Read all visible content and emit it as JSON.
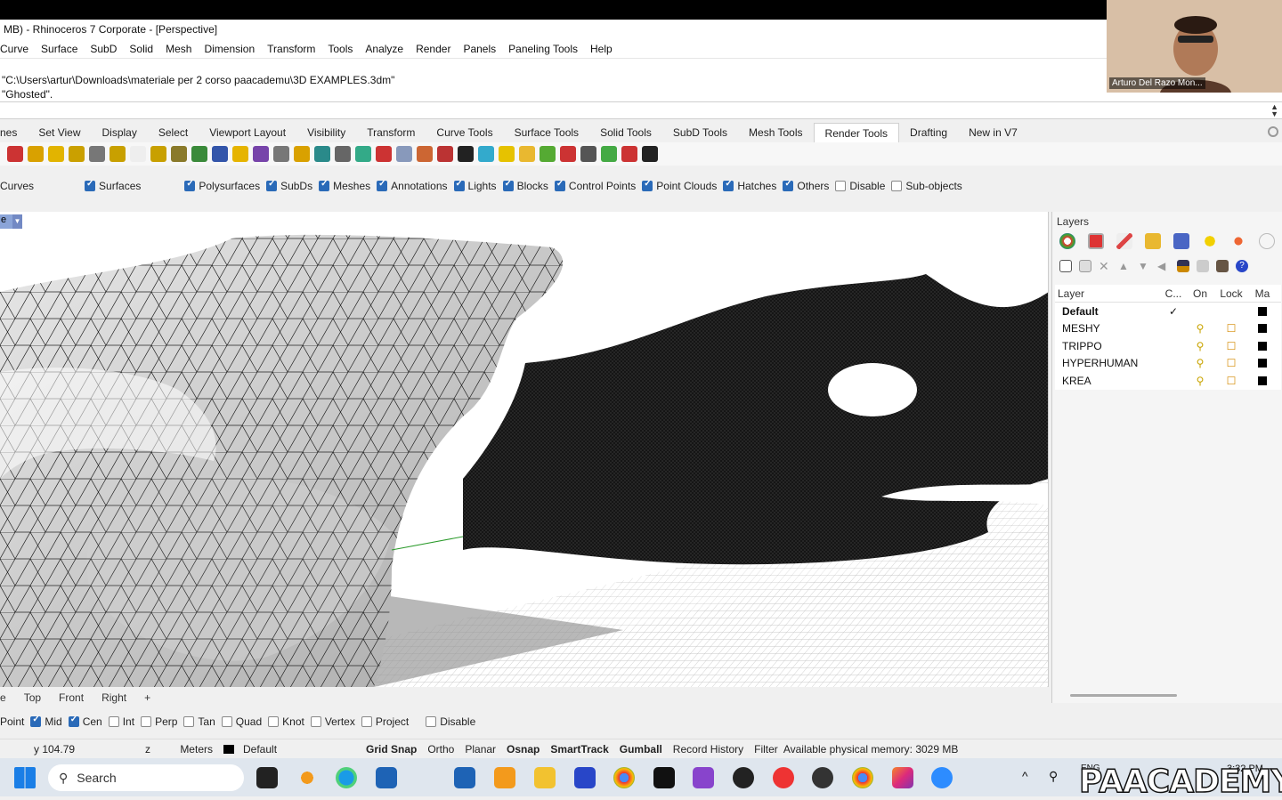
{
  "window": {
    "title": "MB) - Rhinoceros 7 Corporate - [Perspective]"
  },
  "menu": [
    "Curve",
    "Surface",
    "SubD",
    "Solid",
    "Mesh",
    "Dimension",
    "Transform",
    "Tools",
    "Analyze",
    "Render",
    "Panels",
    "Paneling Tools",
    "Help"
  ],
  "command_history": [
    "\"C:\\Users\\artur\\Downloads\\materiale per 2 corso paacademu\\3D EXAMPLES.3dm\"",
    "\"Ghosted\"."
  ],
  "tabs": [
    "nes",
    "Set View",
    "Display",
    "Select",
    "Viewport Layout",
    "Visibility",
    "Transform",
    "Curve Tools",
    "Surface Tools",
    "Solid Tools",
    "SubD Tools",
    "Mesh Tools",
    "Render Tools",
    "Drafting",
    "New in V7"
  ],
  "active_tab": "Render Tools",
  "filters": [
    {
      "label": "Curves",
      "checked": true
    },
    {
      "label": "Surfaces",
      "checked": true
    },
    {
      "label": "Polysurfaces",
      "checked": true
    },
    {
      "label": "SubDs",
      "checked": true
    },
    {
      "label": "Meshes",
      "checked": true
    },
    {
      "label": "Annotations",
      "checked": true
    },
    {
      "label": "Lights",
      "checked": true
    },
    {
      "label": "Blocks",
      "checked": true
    },
    {
      "label": "Control Points",
      "checked": true
    },
    {
      "label": "Point Clouds",
      "checked": true
    },
    {
      "label": "Hatches",
      "checked": true
    },
    {
      "label": "Others",
      "checked": true
    },
    {
      "label": "Disable",
      "checked": false
    },
    {
      "label": "Sub-objects",
      "checked": false
    }
  ],
  "viewport": {
    "label": "e"
  },
  "layers": {
    "title": "Layers",
    "headers": {
      "layer": "Layer",
      "current": "C...",
      "on": "On",
      "lock": "Lock",
      "material": "Ma"
    },
    "rows": [
      {
        "name": "Default",
        "current": "✓"
      },
      {
        "name": "MESHY",
        "current": ""
      },
      {
        "name": "TRIPPO",
        "current": ""
      },
      {
        "name": "HYPERHUMAN",
        "current": ""
      },
      {
        "name": "KREA",
        "current": ""
      }
    ]
  },
  "view_tabs": [
    "e",
    "Top",
    "Front",
    "Right",
    "+"
  ],
  "osnaps": [
    {
      "label": "Point",
      "checked": null
    },
    {
      "label": "Mid",
      "checked": true
    },
    {
      "label": "Cen",
      "checked": true
    },
    {
      "label": "Int",
      "checked": false
    },
    {
      "label": "Perp",
      "checked": false
    },
    {
      "label": "Tan",
      "checked": false
    },
    {
      "label": "Quad",
      "checked": false
    },
    {
      "label": "Knot",
      "checked": false
    },
    {
      "label": "Vertex",
      "checked": false
    },
    {
      "label": "Project",
      "checked": false
    },
    {
      "label": "Disable",
      "checked": false
    }
  ],
  "status": {
    "y": "y 104.79",
    "z": "z",
    "units": "Meters",
    "layer": "Default",
    "grid_snap": "Grid Snap",
    "ortho": "Ortho",
    "planar": "Planar",
    "osnap": "Osnap",
    "smarttrack": "SmartTrack",
    "gumball": "Gumball",
    "record_history": "Record History",
    "filter": "Filter",
    "memory": "Available physical memory: 3029 MB"
  },
  "taskbar": {
    "search": "Search",
    "lang": "ENG",
    "time": "3:32 PM"
  },
  "webcam": {
    "name": "Arturo Del Razo Mon..."
  },
  "watermark": "PAACADEMY"
}
